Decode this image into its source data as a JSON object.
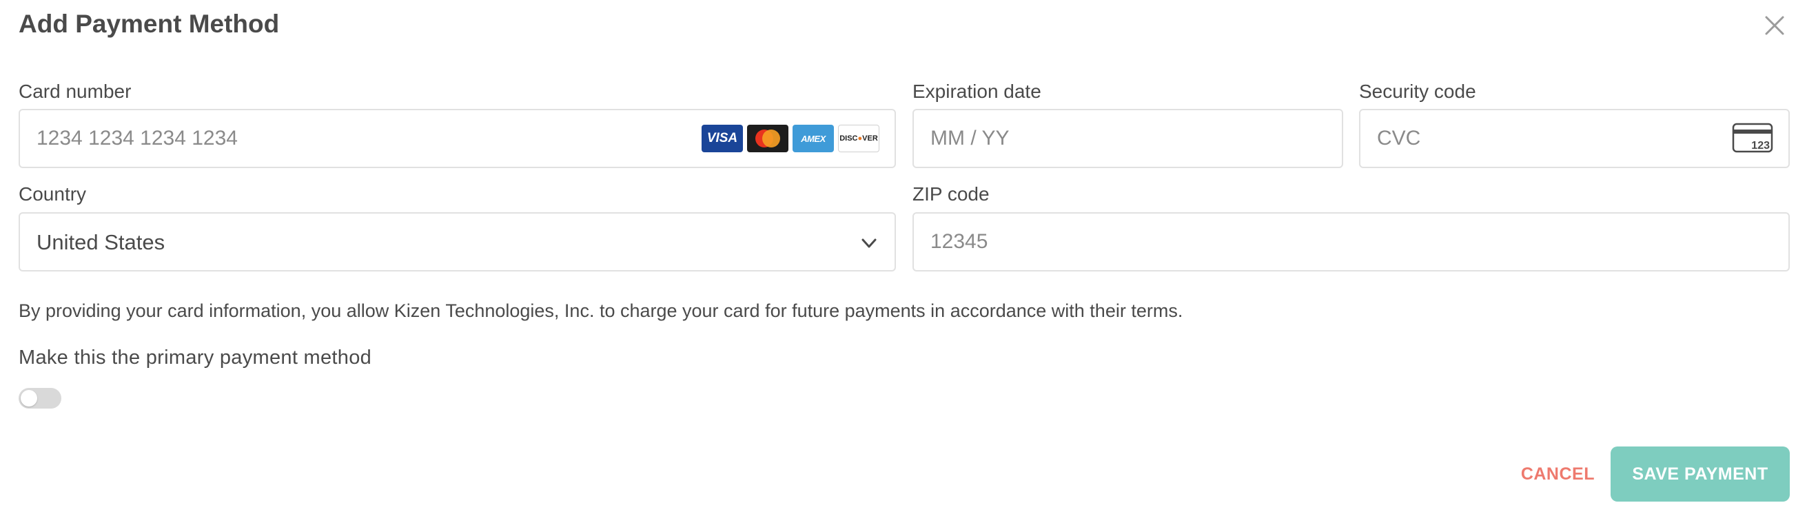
{
  "dialog": {
    "title": "Add Payment Method"
  },
  "card_number": {
    "label": "Card number",
    "placeholder": "1234 1234 1234 1234",
    "value": "",
    "brands": [
      "visa-icon",
      "mastercard-icon",
      "amex-icon",
      "discover-icon"
    ],
    "visa_text": "VISA",
    "amex_text": "AMEX",
    "discover_text": "DISCOVER"
  },
  "expiration": {
    "label": "Expiration date",
    "placeholder": "MM / YY",
    "value": ""
  },
  "security_code": {
    "label": "Security code",
    "placeholder": "CVC",
    "value": "",
    "icon_text": "123"
  },
  "country": {
    "label": "Country",
    "value": "United States"
  },
  "zip": {
    "label": "ZIP code",
    "placeholder": "12345",
    "value": ""
  },
  "terms_text": "By providing your card information, you allow Kizen Technologies, Inc. to charge your card for future payments in accordance with their terms.",
  "primary": {
    "label": "Make this the primary payment method",
    "enabled": false
  },
  "actions": {
    "cancel_label": "CANCEL",
    "save_label": "SAVE PAYMENT"
  },
  "colors": {
    "accent": "#7ecdbf",
    "cancel": "#ee7a6e",
    "text": "#4a4a4a",
    "border": "#e1e1e1"
  }
}
